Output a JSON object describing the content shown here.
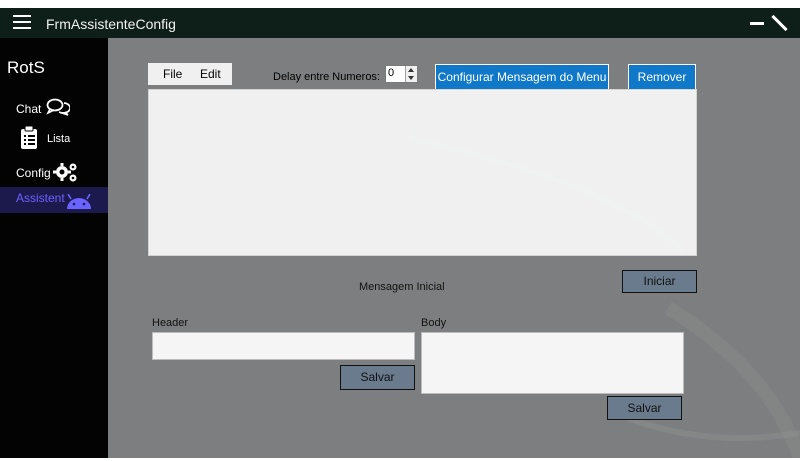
{
  "window": {
    "title": "FrmAssistenteConfig"
  },
  "sidebar": {
    "brand": "RotS",
    "items": [
      {
        "label": "Chat",
        "icon": "chat-icon",
        "active": false
      },
      {
        "label": "Lista",
        "icon": "clipboard-list-icon",
        "active": false
      },
      {
        "label": "Config",
        "icon": "gears-icon",
        "active": false
      },
      {
        "label": "Assistent",
        "icon": "android-icon",
        "active": true
      }
    ]
  },
  "menubar": {
    "file": "File",
    "edit": "Edit"
  },
  "delay": {
    "label": "Delay entre Numeros:",
    "value": "0"
  },
  "buttons": {
    "configurar": "Configurar Mensagem do Menu",
    "remover": "Remover",
    "iniciar": "Iniciar",
    "salvar_header": "Salvar",
    "salvar_body": "Salvar"
  },
  "labels": {
    "mensagem_inicial": "Mensagem Inicial",
    "header": "Header",
    "body": "Body"
  },
  "fields": {
    "header_value": "",
    "body_value": ""
  },
  "colors": {
    "titlebar": "#0e1e19",
    "sidebar": "#030303",
    "sidebar_active_bg": "#1c1a4d",
    "sidebar_active_text": "#6a63ff",
    "content_bg": "#7d7e7f",
    "accent_button": "#0f78c8",
    "gray_button": "#6a7b8d"
  }
}
